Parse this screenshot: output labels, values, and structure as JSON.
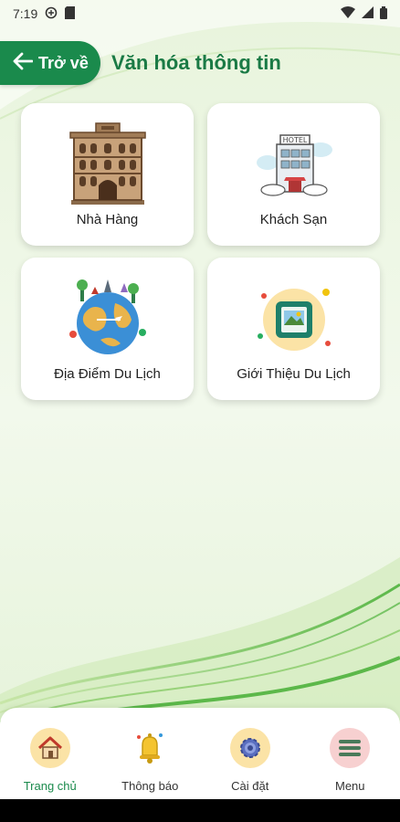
{
  "status_bar": {
    "time": "7:19"
  },
  "header": {
    "back_label": "Trở về",
    "title": "Văn hóa thông tin"
  },
  "cards": [
    {
      "label": "Nhà Hàng",
      "icon": "restaurant-building-icon"
    },
    {
      "label": "Khách Sạn",
      "icon": "hotel-icon"
    },
    {
      "label": "Địa Điểm Du Lịch",
      "icon": "globe-landmarks-icon"
    },
    {
      "label": "Giới Thiệu Du Lịch",
      "icon": "photo-frame-icon"
    }
  ],
  "bottom_nav": [
    {
      "label": "Trang chủ",
      "icon": "home-icon",
      "active": true
    },
    {
      "label": "Thông báo",
      "icon": "bell-icon",
      "active": false
    },
    {
      "label": "Cài đặt",
      "icon": "gear-icon",
      "active": false
    },
    {
      "label": "Menu",
      "icon": "menu-icon",
      "active": false
    }
  ],
  "colors": {
    "brand_green": "#1a8a4c",
    "title_green": "#1a7a45"
  }
}
